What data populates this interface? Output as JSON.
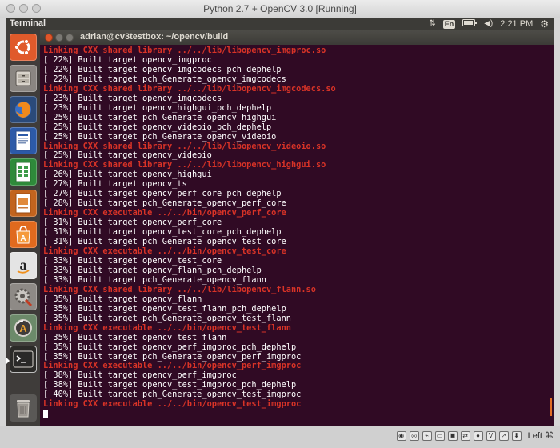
{
  "window": {
    "title": "Python 2.7 + OpenCV 3.0 [Running]"
  },
  "top_panel": {
    "app_name": "Terminal",
    "keyboard_layout": "En",
    "time": "2:21 PM"
  },
  "launcher": {
    "items": [
      {
        "name": "ubuntu-dash",
        "icon": "ubuntu-logo-icon"
      },
      {
        "name": "files",
        "icon": "file-cabinet-icon"
      },
      {
        "name": "firefox",
        "icon": "firefox-icon"
      },
      {
        "name": "libreoffice-writer",
        "icon": "writer-document-icon"
      },
      {
        "name": "libreoffice-calc",
        "icon": "calc-spreadsheet-icon"
      },
      {
        "name": "libreoffice-impress",
        "icon": "impress-presentation-icon"
      },
      {
        "name": "ubuntu-software-center",
        "icon": "shopping-bag-icon"
      },
      {
        "name": "amazon",
        "icon": "amazon-icon"
      },
      {
        "name": "system-settings",
        "icon": "settings-gear-icon"
      },
      {
        "name": "software-updater",
        "icon": "updater-icon"
      },
      {
        "name": "terminal",
        "icon": "terminal-icon"
      },
      {
        "name": "trash",
        "icon": "trash-icon"
      }
    ]
  },
  "terminal": {
    "title": "adrian@cv3testbox: ~/opencv/build",
    "lines": [
      {
        "text": "Linking CXX shared library ../../lib/libopencv_imgproc.so",
        "type": "error"
      },
      {
        "text": "[ 22%] Built target opencv_imgproc",
        "type": "normal"
      },
      {
        "text": "[ 22%] Built target opencv_imgcodecs_pch_dephelp",
        "type": "normal"
      },
      {
        "text": "[ 22%] Built target pch_Generate_opencv_imgcodecs",
        "type": "normal"
      },
      {
        "text": "Linking CXX shared library ../../lib/libopencv_imgcodecs.so",
        "type": "error"
      },
      {
        "text": "[ 23%] Built target opencv_imgcodecs",
        "type": "normal"
      },
      {
        "text": "[ 23%] Built target opencv_highgui_pch_dephelp",
        "type": "normal"
      },
      {
        "text": "[ 25%] Built target pch_Generate_opencv_highgui",
        "type": "normal"
      },
      {
        "text": "[ 25%] Built target opencv_videoio_pch_dephelp",
        "type": "normal"
      },
      {
        "text": "[ 25%] Built target pch_Generate_opencv_videoio",
        "type": "normal"
      },
      {
        "text": "Linking CXX shared library ../../lib/libopencv_videoio.so",
        "type": "error"
      },
      {
        "text": "[ 25%] Built target opencv_videoio",
        "type": "normal"
      },
      {
        "text": "Linking CXX shared library ../../lib/libopencv_highgui.so",
        "type": "error"
      },
      {
        "text": "[ 26%] Built target opencv_highgui",
        "type": "normal"
      },
      {
        "text": "[ 27%] Built target opencv_ts",
        "type": "normal"
      },
      {
        "text": "[ 27%] Built target opencv_perf_core_pch_dephelp",
        "type": "normal"
      },
      {
        "text": "[ 28%] Built target pch_Generate_opencv_perf_core",
        "type": "normal"
      },
      {
        "text": "Linking CXX executable ../../bin/opencv_perf_core",
        "type": "error"
      },
      {
        "text": "[ 31%] Built target opencv_perf_core",
        "type": "normal"
      },
      {
        "text": "[ 31%] Built target opencv_test_core_pch_dephelp",
        "type": "normal"
      },
      {
        "text": "[ 31%] Built target pch_Generate_opencv_test_core",
        "type": "normal"
      },
      {
        "text": "Linking CXX executable ../../bin/opencv_test_core",
        "type": "error"
      },
      {
        "text": "[ 33%] Built target opencv_test_core",
        "type": "normal"
      },
      {
        "text": "[ 33%] Built target opencv_flann_pch_dephelp",
        "type": "normal"
      },
      {
        "text": "[ 33%] Built target pch_Generate_opencv_flann",
        "type": "normal"
      },
      {
        "text": "Linking CXX shared library ../../lib/libopencv_flann.so",
        "type": "error"
      },
      {
        "text": "[ 35%] Built target opencv_flann",
        "type": "normal"
      },
      {
        "text": "[ 35%] Built target opencv_test_flann_pch_dephelp",
        "type": "normal"
      },
      {
        "text": "[ 35%] Built target pch_Generate_opencv_test_flann",
        "type": "normal"
      },
      {
        "text": "Linking CXX executable ../../bin/opencv_test_flann",
        "type": "error"
      },
      {
        "text": "[ 35%] Built target opencv_test_flann",
        "type": "normal"
      },
      {
        "text": "[ 35%] Built target opencv_perf_imgproc_pch_dephelp",
        "type": "normal"
      },
      {
        "text": "[ 35%] Built target pch_Generate_opencv_perf_imgproc",
        "type": "normal"
      },
      {
        "text": "Linking CXX executable ../../bin/opencv_perf_imgproc",
        "type": "error"
      },
      {
        "text": "[ 38%] Built target opencv_perf_imgproc",
        "type": "normal"
      },
      {
        "text": "[ 38%] Built target opencv_test_imgproc_pch_dephelp",
        "type": "normal"
      },
      {
        "text": "[ 40%] Built target pch_Generate_opencv_test_imgproc",
        "type": "normal"
      },
      {
        "text": "Linking CXX executable ../../bin/opencv_test_imgproc",
        "type": "error"
      }
    ]
  },
  "status_bar": {
    "host_key": "Left ⌘"
  },
  "colors": {
    "terminal_bg": "#300a24",
    "error_text": "#d83327",
    "normal_text": "#ffffff",
    "panel_bg": "#3c3b37",
    "launcher_bg": "#3f3c3a"
  }
}
